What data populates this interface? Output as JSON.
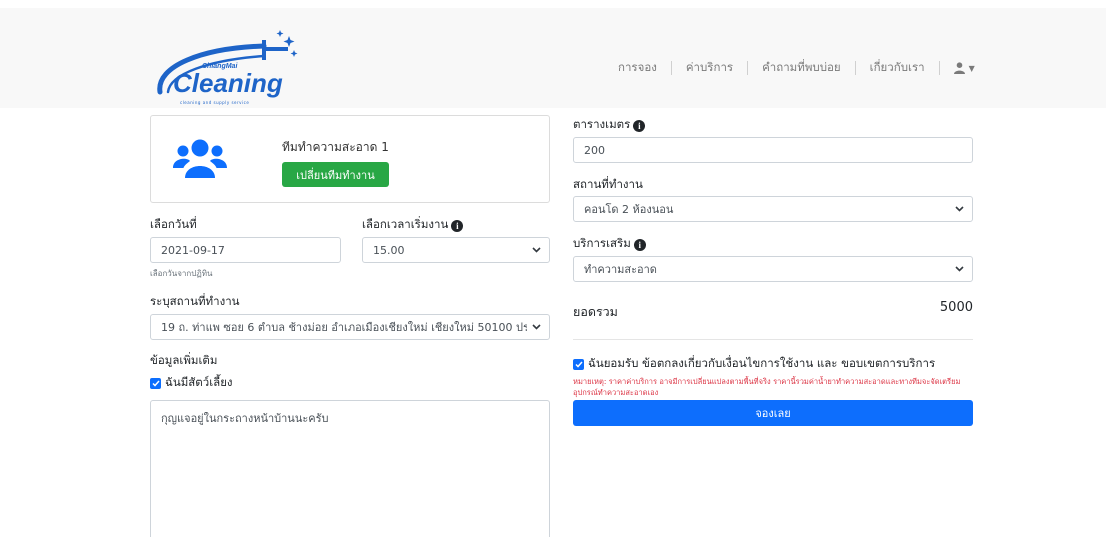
{
  "header": {
    "logo": {
      "small": "ChiangMai",
      "word": "Cleaning",
      "tagline": "cleaning and supply service"
    },
    "nav": [
      {
        "label": "การจอง"
      },
      {
        "label": "ค่าบริการ"
      },
      {
        "label": "คำถามที่พบบ่อย"
      },
      {
        "label": "เกี่ยวกับเรา"
      }
    ],
    "user_icon": "user-icon"
  },
  "team": {
    "name": "ทีมทำความสะอาด 1",
    "change_button": "เปลี่ยนทีมทำงาน",
    "icon": "users-icon"
  },
  "form_left": {
    "date_label": "เลือกวันที่",
    "date_value": "2021-09-17",
    "date_help": "เลือกวันจากปฏิทิน",
    "time_label": "เลือกเวลาเริ่มงาน",
    "time_value": "15.00",
    "location_label": "ระบุสถานที่ทำงาน",
    "location_value": "19 ถ. ท่าแพ ซอย 6 ตำบล ช้างม่อย อำเภอเมืองเชียงใหม่ เชียงใหม่ 50100 ประเทศไทย",
    "extra_label": "ข้อมูลเพิ่มเติม",
    "pet_label": "ฉันมีสัตว์เลี้ยง",
    "note_value": "กุญแจอยู่ในกระถางหน้าบ้านนะครับ"
  },
  "form_right": {
    "sqm_label": "ตารางเมตร",
    "sqm_value": "200",
    "place_label": "สถานที่ทำงาน",
    "place_value": "คอนโด 2 ห้องนอน",
    "extra_service_label": "บริการเสริม",
    "extra_service_value": "ทำความสะอาด",
    "total_label": "ยอดรวม",
    "total_value": "5000",
    "agree_label": "ฉันยอมรับ ข้อตกลงเกี่ยวกับเงื่อนไขการใช้งาน และ ขอบเขตการบริการ",
    "note": "หมายเหตุ: ราคาค่าบริการ อาจมีการเปลี่ยนแปลงตามพื้นที่จริง ราคานี้รวมค่าน้ำยาทำความสะอาดและทางทีมจะจัดเตรียมอุปกรณ์ทำความสะอาดเอง",
    "book_button": "จองเลย"
  },
  "colors": {
    "primary": "#0d6efd",
    "success": "#28a745",
    "danger": "#dc3545",
    "logo": "#1e64c8",
    "navbar_bg": "#f8f8f8"
  }
}
